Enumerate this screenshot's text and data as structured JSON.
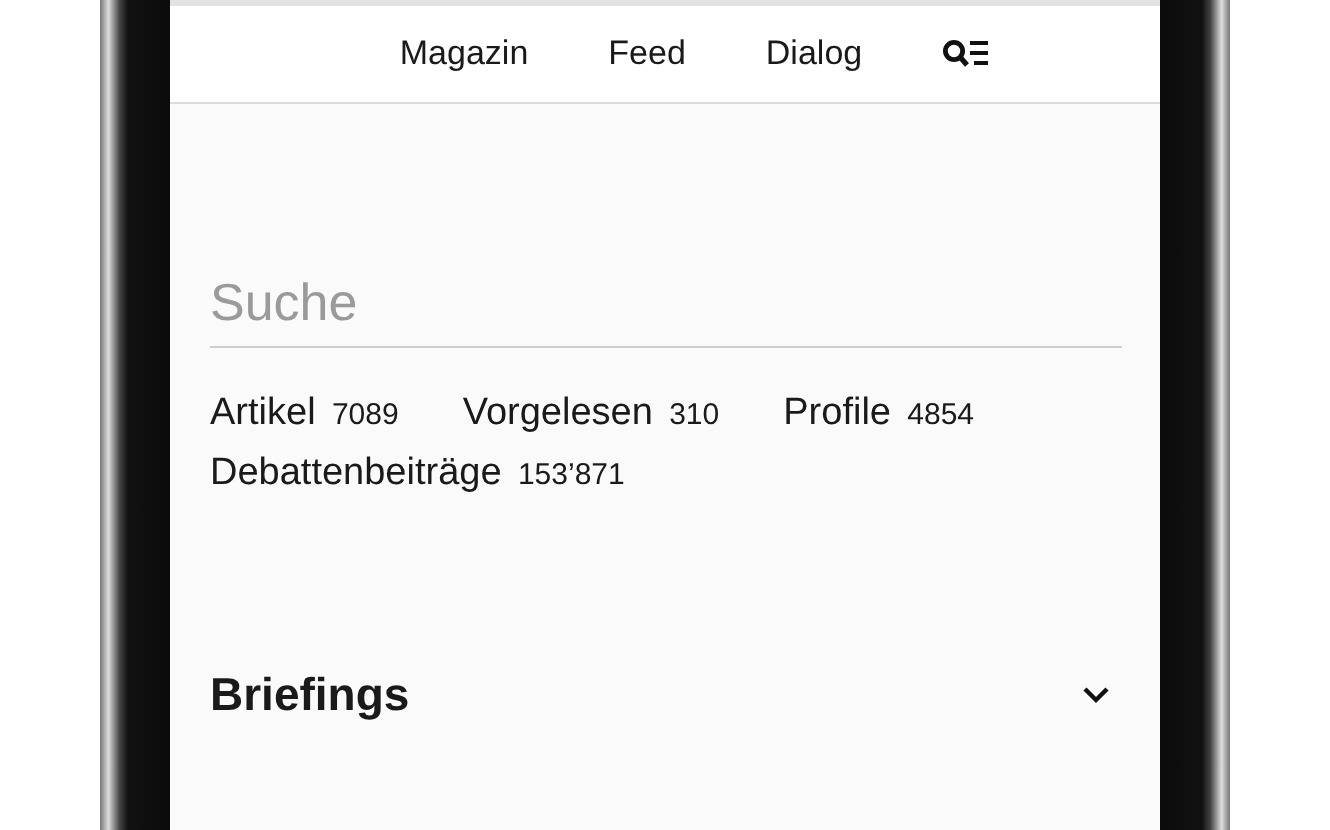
{
  "nav": {
    "items": [
      "Magazin",
      "Feed",
      "Dialog"
    ]
  },
  "search": {
    "placeholder": "Suche"
  },
  "counts": [
    {
      "label": "Artikel",
      "count": "7089"
    },
    {
      "label": "Vorgelesen",
      "count": "310"
    },
    {
      "label": "Profile",
      "count": "4854"
    },
    {
      "label": "Debattenbeiträge",
      "count": "153’871"
    }
  ],
  "section": {
    "title": "Briefings",
    "expanded": false
  }
}
